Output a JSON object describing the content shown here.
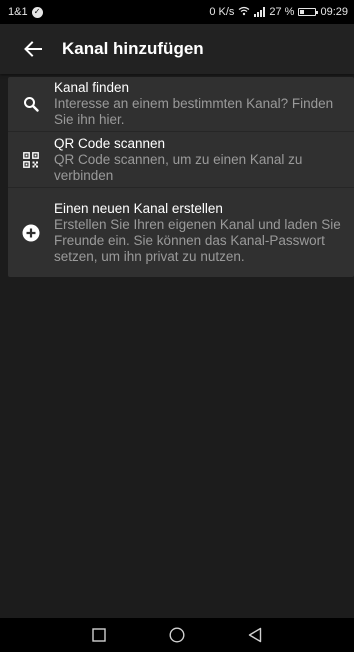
{
  "status_bar": {
    "carrier": "1&1",
    "net_speed": "0 K/s",
    "battery_percent": "27 %",
    "time": "09:29"
  },
  "app_bar": {
    "title": "Kanal hinzufügen"
  },
  "options": [
    {
      "title": "Kanal finden",
      "description": "Interesse an einem bestimmten Kanal? Finden Sie ihn hier.",
      "icon": "search-icon"
    },
    {
      "title": "QR Code scannen",
      "description": "QR Code scannen, um zu einen Kanal zu verbinden",
      "icon": "qr-code-icon"
    },
    {
      "title": "Einen neuen Kanal erstellen",
      "description": "Erstellen Sie Ihren eigenen Kanal und laden Sie Freunde ein. Sie können das Kanal-Passwort setzen, um ihn privat zu nutzen.",
      "icon": "add-circle-icon"
    }
  ],
  "colors": {
    "background": "#1c1c1c",
    "card": "#303030",
    "app_bar": "#222222",
    "secondary_text": "#9a9a9a"
  }
}
